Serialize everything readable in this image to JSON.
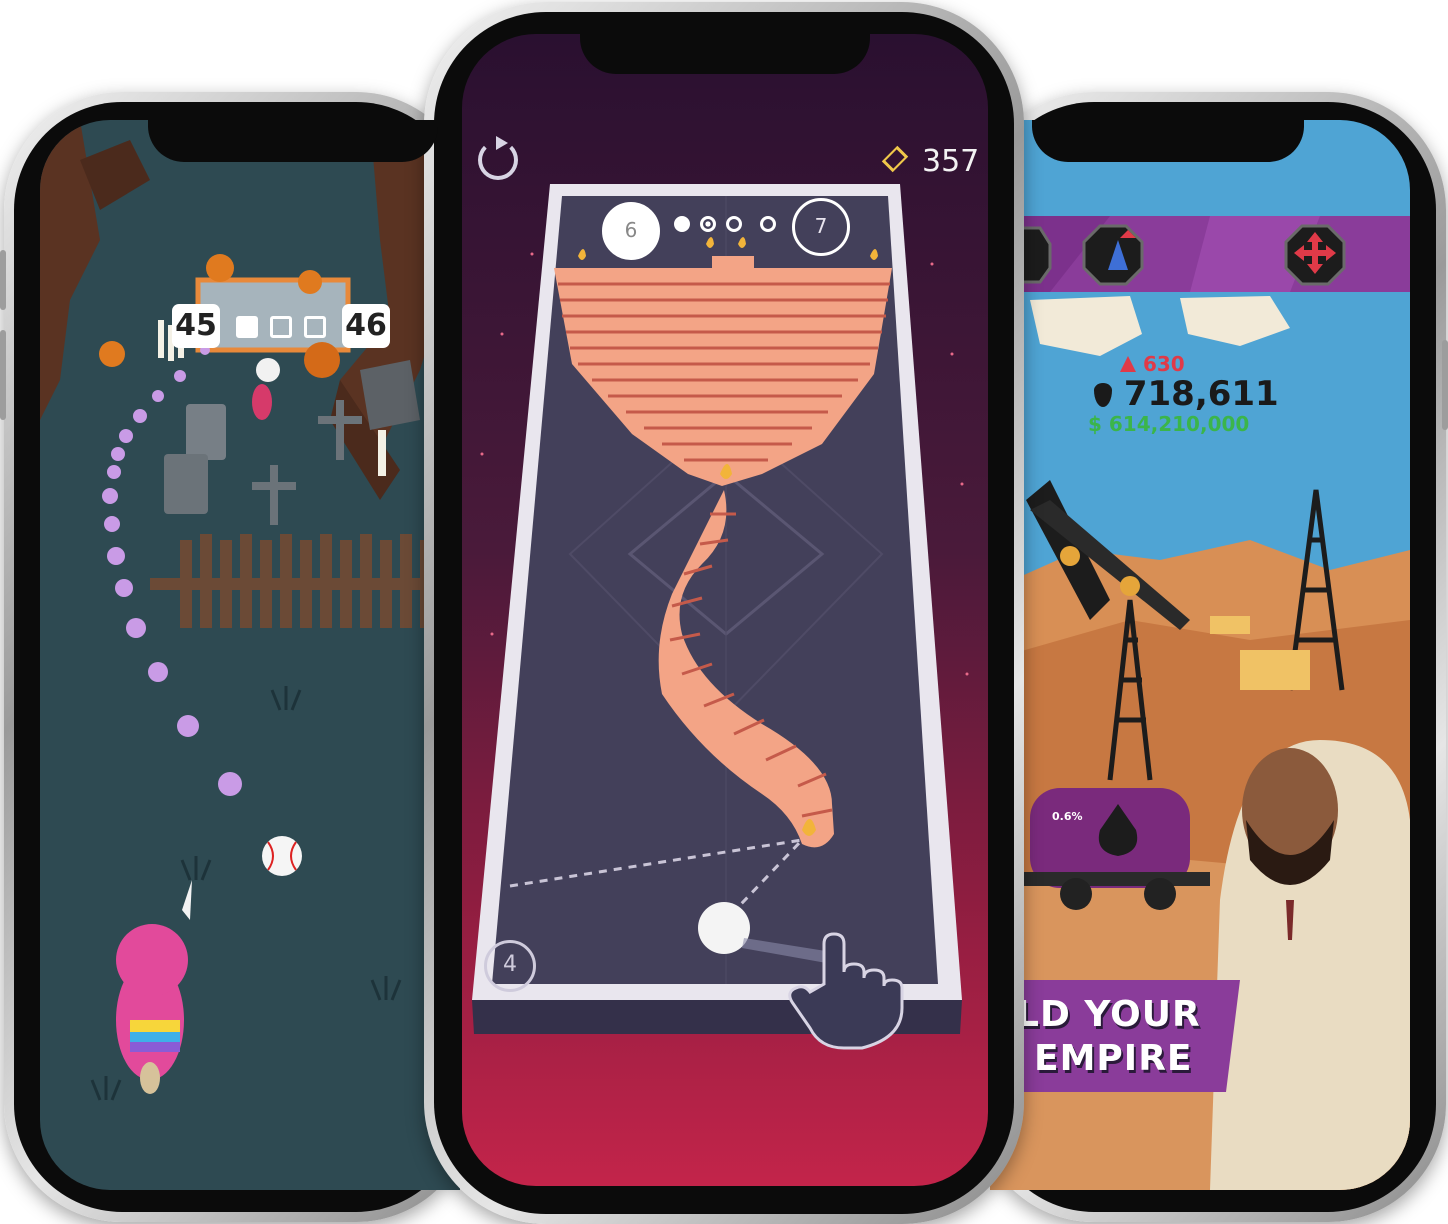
{
  "left_game": {
    "score_left": "45",
    "score_right": "46",
    "progress": [
      true,
      false,
      false
    ]
  },
  "center_game": {
    "gem_count": "357",
    "current_level": "6",
    "next_level": "7",
    "balls_left": "4"
  },
  "right_game": {
    "gems": "630",
    "oil": "718,611",
    "money": "$ 614,210,000",
    "tank_percent": "0.6%",
    "banner_line1": "LD YOUR",
    "banner_line2": "EMPIRE"
  },
  "colors": {
    "left_bg": "#2e4a52",
    "center_bg_top": "#2a1030",
    "center_bg_bottom": "#b8213f",
    "right_sky": "#4fa4d4",
    "right_top_bar": "#8a3c9a",
    "money_green": "#3bb54a",
    "gem_red": "#e03a48"
  }
}
